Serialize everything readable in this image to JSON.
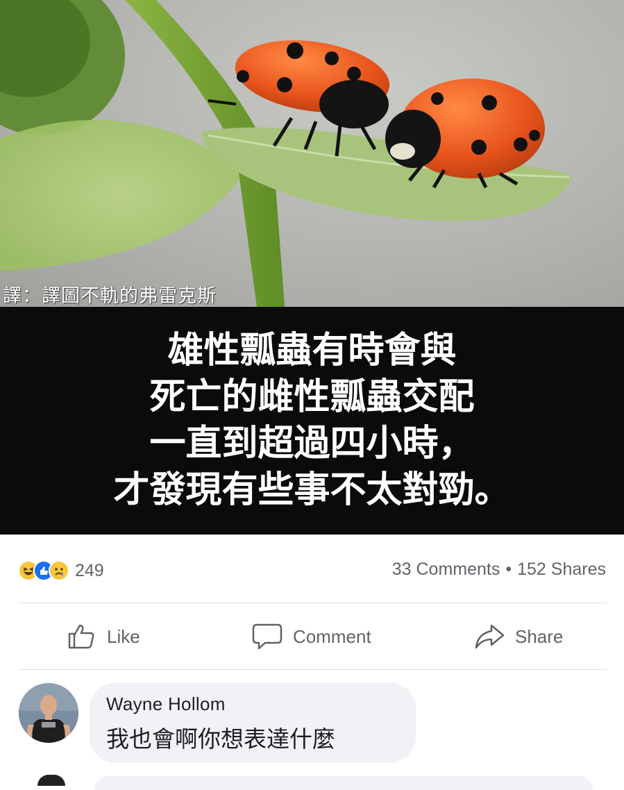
{
  "post": {
    "photo": {
      "watermark": "譯：譯圖不軌的弗雷克斯",
      "subject": "two-ladybugs-on-leaf"
    },
    "caption_lines": [
      "雄性瓢蟲有時會與",
      "死亡的雌性瓢蟲交配",
      "一直到超過四小時，",
      "才發現有些事不太對勁。"
    ],
    "reactions": {
      "icons": [
        "haha-icon",
        "like-icon",
        "sad-icon"
      ],
      "count": "249"
    },
    "comments_count": "33 Comments",
    "separator": "•",
    "shares_count": "152 Shares",
    "actions": {
      "like": "Like",
      "comment": "Comment",
      "share": "Share"
    }
  },
  "comments": [
    {
      "author": "Wayne Hollom",
      "text": "我也會啊你想表達什麼"
    }
  ],
  "colors": {
    "caption_bg": "#0b0b0b",
    "muted_text": "#5f6368",
    "bubble_bg": "#f0f2f5",
    "like_blue": "#1a6ff0",
    "reaction_yellow": "#f7c63c",
    "ladybug_orange": "#e8541c"
  }
}
